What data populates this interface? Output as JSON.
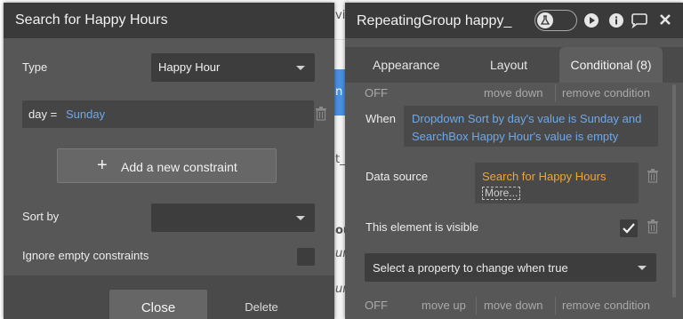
{
  "background": {
    "fragments": [
      "vi",
      "n",
      "t_",
      "ou",
      "un",
      "ur",
      "ll",
      "ir",
      "pz",
      "pe"
    ]
  },
  "search_panel": {
    "title": "Search for Happy Hours",
    "type_label": "Type",
    "type_value": "Happy Hour",
    "constraint": {
      "field": "day =",
      "value": "Sunday"
    },
    "add_constraint_label": "Add a new constraint",
    "sort_by_label": "Sort by",
    "sort_by_value": "",
    "ignore_empty_label": "Ignore empty constraints",
    "ignore_empty_checked": false,
    "close_label": "Close",
    "delete_label": "Delete"
  },
  "property_panel": {
    "title": "RepeatingGroup happy_",
    "tabs": [
      {
        "label": "Appearance",
        "active": false
      },
      {
        "label": "Layout",
        "active": false
      },
      {
        "label": "Conditional (8)",
        "active": true
      }
    ],
    "condition_top": {
      "off": "OFF",
      "move_down": "move down",
      "remove": "remove condition"
    },
    "when_label": "When",
    "when_expression": "Dropdown Sort by day's value is Sunday and SearchBox Happy Hour's value is empty",
    "data_source_label": "Data source",
    "data_source_value": "Search for Happy Hours",
    "data_source_more": "More...",
    "visible_label": "This element is visible",
    "visible_checked": true,
    "select_property_placeholder": "Select a property to change when true",
    "condition_bottom": {
      "off": "OFF",
      "move_up": "move up",
      "move_down": "move down",
      "remove": "remove condition"
    }
  },
  "colors": {
    "panel": "#575757",
    "header": "#3a3a3a",
    "accent_blue": "#6fa8e8",
    "accent_orange": "#f0a43a"
  }
}
